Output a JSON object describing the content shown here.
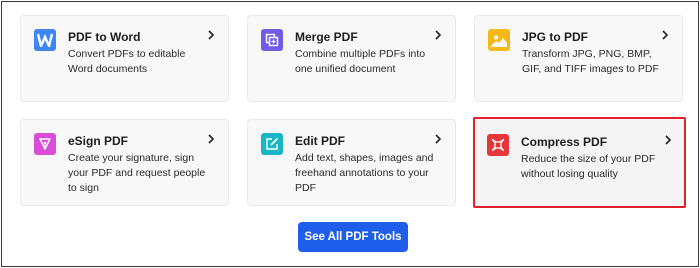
{
  "cards": [
    {
      "title": "PDF to Word",
      "desc": "Convert PDFs to editable Word documents",
      "icon": "word-icon",
      "color": "#3d86f6"
    },
    {
      "title": "Merge PDF",
      "desc": "Combine multiple PDFs into one unified document",
      "icon": "merge-icon",
      "color": "#6f5ce6"
    },
    {
      "title": "JPG to PDF",
      "desc": "Transform JPG, PNG, BMP, GIF, and TIFF images to PDF",
      "icon": "image-icon",
      "color": "#f5b818"
    },
    {
      "title": "eSign PDF",
      "desc": "Create your signature, sign your PDF and request people to sign",
      "icon": "pen-icon",
      "color": "#d84ed9"
    },
    {
      "title": "Edit PDF",
      "desc": "Add text, shapes, images and freehand annotations to your PDF",
      "icon": "edit-icon",
      "color": "#19b7c4"
    },
    {
      "title": "Compress PDF",
      "desc": "Reduce the size of your PDF without losing quality",
      "icon": "compress-icon",
      "color": "#e8373a"
    }
  ],
  "see_all_label": "See All PDF Tools",
  "highlight_color": "#e0202a",
  "button_color": "#1f5eea"
}
